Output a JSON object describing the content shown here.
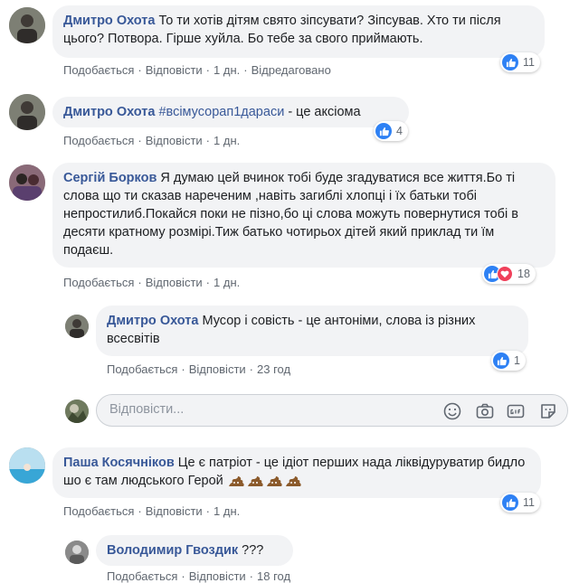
{
  "comments": [
    {
      "author": "Дмитро Охота",
      "text": "То ти хотів дітям свято зіпсувати? Зіпсував. Хто ти після цього? Потвора. Гірше хуйла. Бо тебе за свого приймають.",
      "like": "Подобається",
      "reply": "Відповісти",
      "time": "1 дн.",
      "edited": "Відредаговано",
      "reactions": "11"
    },
    {
      "author": "Дмитро Охота",
      "hashtag": "#всімусорап1дараси",
      "text": "- це аксіома",
      "like": "Подобається",
      "reply": "Відповісти",
      "time": "1 дн.",
      "reactions": "4"
    },
    {
      "author": "Сергій Борков",
      "text": "Я думаю цей вчинок тобі буде згадуватися все життя.Бо ті слова що ти сказав нареченим ,навіть загиблі хлопці і їх батьки тобі непростилиб.Покайся поки не пізно,бо ці слова можуть повернутися тобі в десяти кратному розмірі.Тиж батько чотирьох дітей який приклад ти їм подаєш.",
      "like": "Подобається",
      "reply": "Відповісти",
      "time": "1 дн.",
      "reactions": "18"
    },
    {
      "author": "Дмитро Охота",
      "text": "Мусор і совість - це антоніми, слова із різних всесвітів",
      "like": "Подобається",
      "reply": "Відповісти",
      "time": "23 год",
      "reactions": "1"
    },
    {
      "author": "Паша Косячніков",
      "text": "Це є патріот - це ідіот перших нада ліквідуруватир бидло шо є там людського Герой",
      "like": "Подобається",
      "reply": "Відповісти",
      "time": "1 дн.",
      "reactions": "11"
    },
    {
      "author": "Володимир Гвоздик",
      "text": "???",
      "like": "Подобається",
      "reply": "Відповісти",
      "time": "18 год"
    }
  ],
  "reply_box": {
    "placeholder": "Відповісти..."
  },
  "icons": {
    "emoji": "smiley-icon",
    "camera": "camera-icon",
    "gif": "gif-icon",
    "sticker": "sticker-icon"
  },
  "colors": {
    "author": "#385898",
    "like": "#2e81f4",
    "love": "#f0405a",
    "bubble": "#f2f3f5"
  }
}
